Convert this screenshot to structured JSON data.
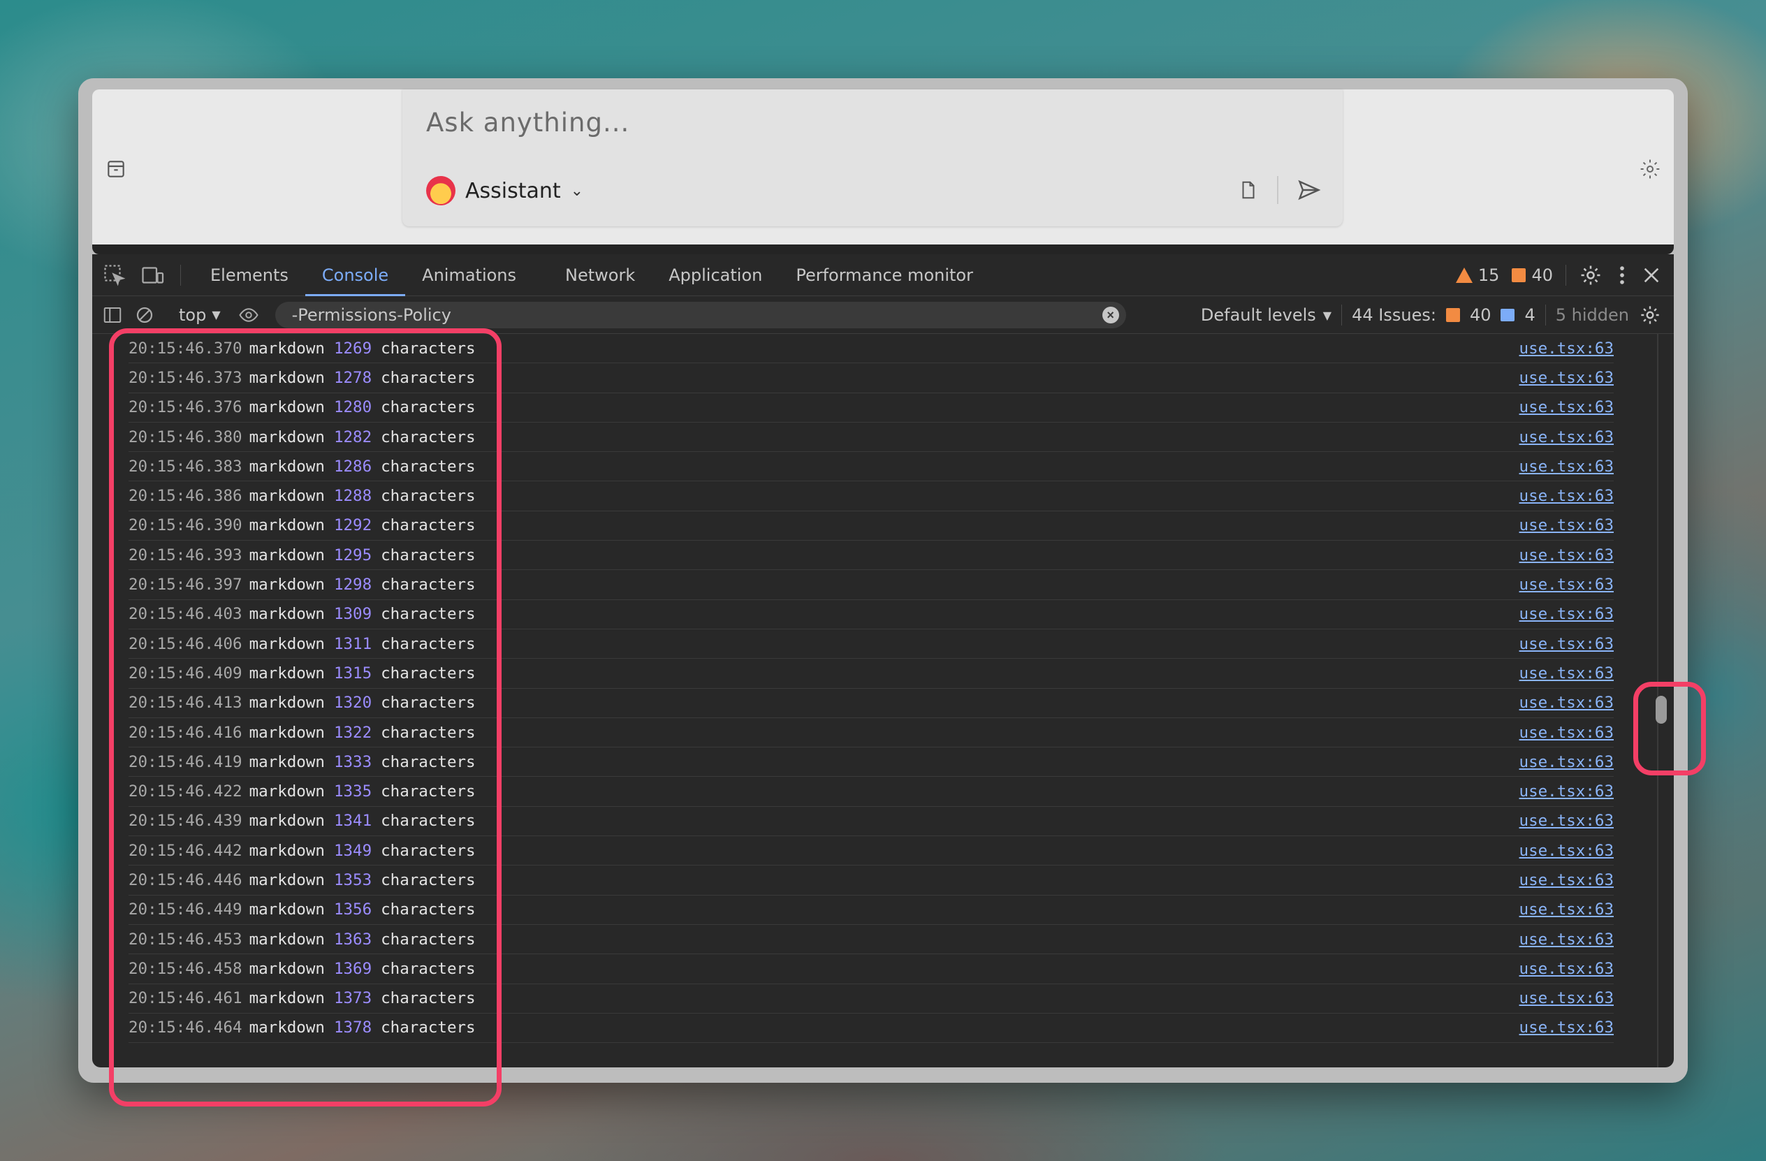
{
  "chat": {
    "placeholder": "Ask anything...",
    "assistant_label": "Assistant"
  },
  "devtools": {
    "tabs": [
      "Elements",
      "Console",
      "Animations",
      "Network",
      "Application",
      "Performance monitor"
    ],
    "active_tab": "Console",
    "warnings_count": "15",
    "errors_count": "40",
    "filter": {
      "context": "top",
      "value": "-Permissions-Policy",
      "levels": "Default levels",
      "issues_label": "44 Issues:",
      "issues_errors": "40",
      "issues_info": "4",
      "hidden": "5 hidden"
    }
  },
  "console_rows": [
    {
      "time": "20:15:46.370",
      "word": "markdown",
      "count": "1269",
      "unit": "characters",
      "source": "use.tsx:63"
    },
    {
      "time": "20:15:46.373",
      "word": "markdown",
      "count": "1278",
      "unit": "characters",
      "source": "use.tsx:63"
    },
    {
      "time": "20:15:46.376",
      "word": "markdown",
      "count": "1280",
      "unit": "characters",
      "source": "use.tsx:63"
    },
    {
      "time": "20:15:46.380",
      "word": "markdown",
      "count": "1282",
      "unit": "characters",
      "source": "use.tsx:63"
    },
    {
      "time": "20:15:46.383",
      "word": "markdown",
      "count": "1286",
      "unit": "characters",
      "source": "use.tsx:63"
    },
    {
      "time": "20:15:46.386",
      "word": "markdown",
      "count": "1288",
      "unit": "characters",
      "source": "use.tsx:63"
    },
    {
      "time": "20:15:46.390",
      "word": "markdown",
      "count": "1292",
      "unit": "characters",
      "source": "use.tsx:63"
    },
    {
      "time": "20:15:46.393",
      "word": "markdown",
      "count": "1295",
      "unit": "characters",
      "source": "use.tsx:63"
    },
    {
      "time": "20:15:46.397",
      "word": "markdown",
      "count": "1298",
      "unit": "characters",
      "source": "use.tsx:63"
    },
    {
      "time": "20:15:46.403",
      "word": "markdown",
      "count": "1309",
      "unit": "characters",
      "source": "use.tsx:63"
    },
    {
      "time": "20:15:46.406",
      "word": "markdown",
      "count": "1311",
      "unit": "characters",
      "source": "use.tsx:63"
    },
    {
      "time": "20:15:46.409",
      "word": "markdown",
      "count": "1315",
      "unit": "characters",
      "source": "use.tsx:63"
    },
    {
      "time": "20:15:46.413",
      "word": "markdown",
      "count": "1320",
      "unit": "characters",
      "source": "use.tsx:63"
    },
    {
      "time": "20:15:46.416",
      "word": "markdown",
      "count": "1322",
      "unit": "characters",
      "source": "use.tsx:63"
    },
    {
      "time": "20:15:46.419",
      "word": "markdown",
      "count": "1333",
      "unit": "characters",
      "source": "use.tsx:63"
    },
    {
      "time": "20:15:46.422",
      "word": "markdown",
      "count": "1335",
      "unit": "characters",
      "source": "use.tsx:63"
    },
    {
      "time": "20:15:46.439",
      "word": "markdown",
      "count": "1341",
      "unit": "characters",
      "source": "use.tsx:63"
    },
    {
      "time": "20:15:46.442",
      "word": "markdown",
      "count": "1349",
      "unit": "characters",
      "source": "use.tsx:63"
    },
    {
      "time": "20:15:46.446",
      "word": "markdown",
      "count": "1353",
      "unit": "characters",
      "source": "use.tsx:63"
    },
    {
      "time": "20:15:46.449",
      "word": "markdown",
      "count": "1356",
      "unit": "characters",
      "source": "use.tsx:63"
    },
    {
      "time": "20:15:46.453",
      "word": "markdown",
      "count": "1363",
      "unit": "characters",
      "source": "use.tsx:63"
    },
    {
      "time": "20:15:46.458",
      "word": "markdown",
      "count": "1369",
      "unit": "characters",
      "source": "use.tsx:63"
    },
    {
      "time": "20:15:46.461",
      "word": "markdown",
      "count": "1373",
      "unit": "characters",
      "source": "use.tsx:63"
    },
    {
      "time": "20:15:46.464",
      "word": "markdown",
      "count": "1378",
      "unit": "characters",
      "source": "use.tsx:63"
    }
  ],
  "colors": {
    "highlight": "#f43f66",
    "active_tab": "#7cacf8",
    "number": "#9b8cff",
    "link": "#8ab4f8"
  }
}
